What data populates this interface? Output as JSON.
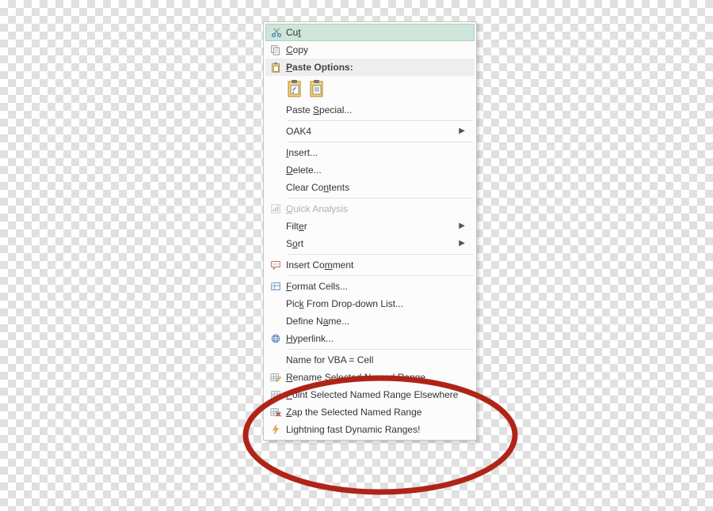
{
  "menu": {
    "cut": "Cu<u>t</u>",
    "copy": "<u>C</u>opy",
    "paste_options": "<u>P</u>aste Options:",
    "paste_special": "Paste <u>S</u>pecial...",
    "oak4": "OAK4",
    "insert": "<u>I</u>nsert...",
    "delete": "<u>D</u>elete...",
    "clear_contents": "Clear Co<u>n</u>tents",
    "quick_analysis": "<u>Q</u>uick Analysis",
    "filter": "Filt<u>e</u>r",
    "sort": "S<u>o</u>rt",
    "insert_comment": "Insert Co<u>m</u>ment",
    "format_cells": "<u>F</u>ormat Cells...",
    "pick_from_list": "Pic<u>k</u> From Drop-down List...",
    "define_name": "Define N<u>a</u>me...",
    "hyperlink": "<u>H</u>yperlink...",
    "name_for_vba": "Name for VBA = Cell",
    "rename_range": "<u>R</u>ename Selected Named Range",
    "point_range": "<u>P</u>oint Selected Named Range Elsewhere",
    "zap_range": "<u>Z</u>ap the Selected Named Range",
    "dynamic_ranges": "Lightning fast Dynamic Ranges!"
  }
}
